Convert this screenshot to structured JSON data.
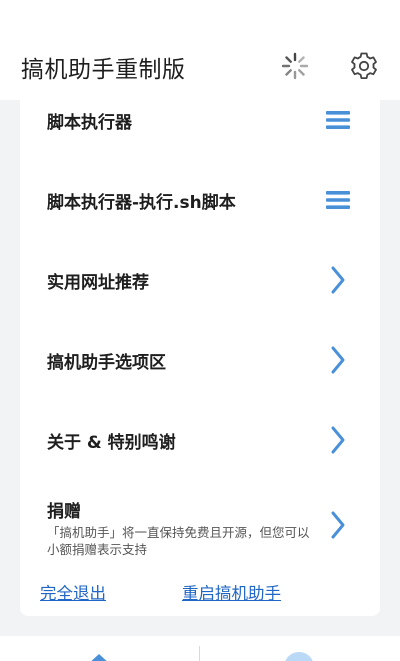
{
  "header": {
    "title": "搞机助手重制版"
  },
  "menu": [
    {
      "label": "脚本执行器",
      "icon": "menu-icon"
    },
    {
      "label": "脚本执行器-执行.sh脚本",
      "icon": "menu-icon"
    },
    {
      "label": "实用网址推荐",
      "icon": "chevron-right-icon"
    },
    {
      "label": "搞机助手选项区",
      "icon": "chevron-right-icon"
    },
    {
      "label": "关于 & 特别鸣谢",
      "icon": "chevron-right-icon"
    }
  ],
  "donate": {
    "label": "捐赠",
    "description": "「搞机助手」将一直保持免费且开源，但您可以小额捐赠表示支持",
    "icon": "chevron-right-icon"
  },
  "links": {
    "exit": "完全退出",
    "restart": "重启搞机助手"
  },
  "colors": {
    "accent": "#4a90d9",
    "link": "#1f66c7",
    "background": "#f1f3f5"
  }
}
